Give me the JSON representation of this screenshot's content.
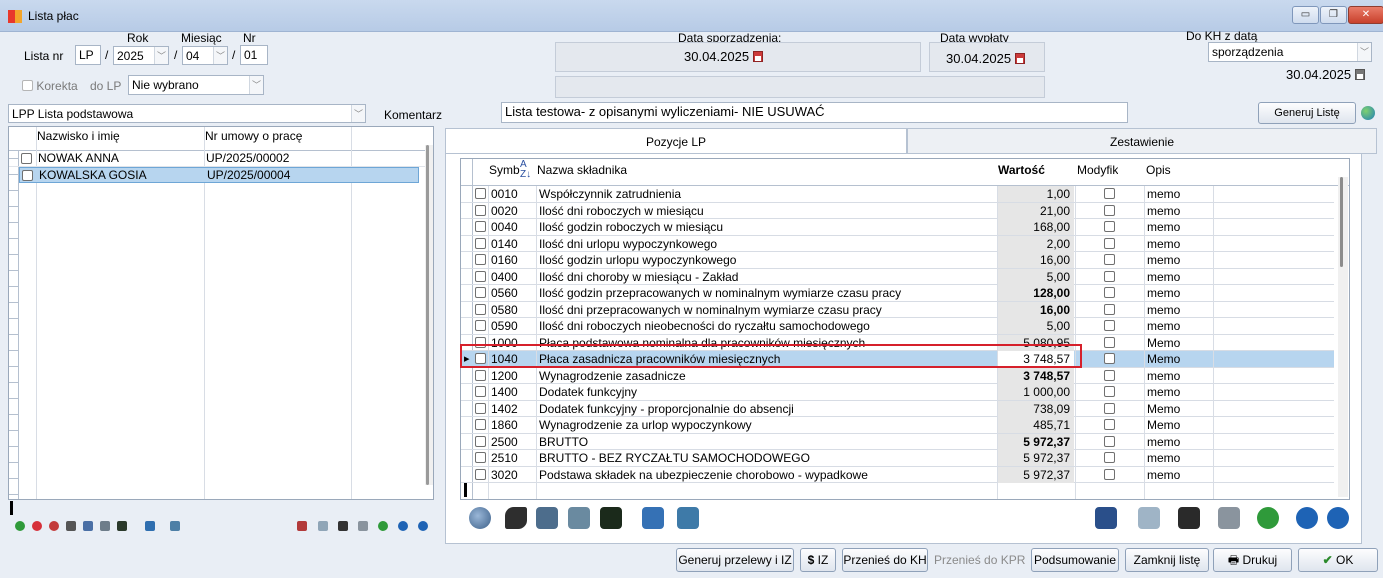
{
  "window": {
    "title": "Lista płac"
  },
  "header": {
    "lista_nr_label": "Lista nr",
    "lista_prefix": "LP",
    "rok_label": "Rok",
    "rok_value": "2025",
    "miesiac_label": "Miesiąc",
    "miesiac_value": "04",
    "nr_label": "Nr",
    "nr_value": "01",
    "sep": "/",
    "korekta_label": "Korekta",
    "do_lp_label": "do LP",
    "do_lp_value": "Nie wybrano",
    "data_sporzadzenia_label": "Data sporządzenia:",
    "data_sporzadzenia_value": "30.04.2025",
    "data_wyplaty_label": "Data wypłaty",
    "data_wyplaty_value": "30.04.2025",
    "do_kh_label": "Do KH z datą",
    "do_kh_value": "sporządzenia",
    "do_kh_date": "30.04.2025",
    "list_type": "LPP Lista podstawowa",
    "komentarz_label": "Komentarz",
    "komentarz_value": "Lista testowa- z opisanymi wyliczeniami- NIE USUWAĆ",
    "generuj_liste": "Generuj Listę"
  },
  "employees": {
    "col_name": "Nazwisko i imię",
    "col_contract": "Nr umowy o pracę",
    "rows": [
      {
        "name": "NOWAK ANNA",
        "contract": "UP/2025/00002"
      },
      {
        "name": "KOWALSKA GOSIA",
        "contract": "UP/2025/00004"
      }
    ]
  },
  "tabs": [
    {
      "label": "Pozycje LP"
    },
    {
      "label": "Zestawienie"
    }
  ],
  "components": {
    "col_symbol": "Symbol",
    "col_name": "Nazwa składnika",
    "col_value": "Wartość",
    "col_modified": "Modyfik",
    "col_desc": "Opis",
    "rows": [
      {
        "symbol": "0010",
        "name": "Współczynnik zatrudnienia",
        "value": "1,00",
        "bold": false,
        "desc": "memo"
      },
      {
        "symbol": "0020",
        "name": "Ilość dni roboczych w miesiącu",
        "value": "21,00",
        "bold": false,
        "desc": "memo"
      },
      {
        "symbol": "0040",
        "name": "Ilość godzin roboczych w miesiącu",
        "value": "168,00",
        "bold": false,
        "desc": "memo"
      },
      {
        "symbol": "0140",
        "name": "Ilość dni urlopu wypoczynkowego",
        "value": "2,00",
        "bold": false,
        "desc": "memo"
      },
      {
        "symbol": "0160",
        "name": "Ilość godzin urlopu wypoczynkowego",
        "value": "16,00",
        "bold": false,
        "desc": "memo"
      },
      {
        "symbol": "0400",
        "name": "Ilość dni choroby w miesiącu - Zakład",
        "value": "5,00",
        "bold": false,
        "desc": "memo"
      },
      {
        "symbol": "0560",
        "name": "Ilość godzin przepracowanych w nominalnym wymiarze czasu pracy",
        "value": "128,00",
        "bold": true,
        "desc": "memo"
      },
      {
        "symbol": "0580",
        "name": "Ilość dni przepracowanych w nominalnym wymiarze czasu pracy",
        "value": "16,00",
        "bold": true,
        "desc": "memo"
      },
      {
        "symbol": "0590",
        "name": "Ilość dni roboczych nieobecności do ryczałtu samochodowego",
        "value": "5,00",
        "bold": false,
        "desc": "memo"
      },
      {
        "symbol": "1000",
        "name": "Płaca podstawowa nominalna dla pracowników miesięcznych",
        "value": "5 080,95",
        "bold": false,
        "desc": "Memo"
      },
      {
        "symbol": "1040",
        "name": "Płaca zasadnicza pracowników miesięcznych",
        "value": "3 748,57",
        "bold": false,
        "desc": "Memo"
      },
      {
        "symbol": "1200",
        "name": "Wynagrodzenie zasadnicze",
        "value": "3 748,57",
        "bold": true,
        "desc": "memo"
      },
      {
        "symbol": "1400",
        "name": "Dodatek funkcyjny",
        "value": "1 000,00",
        "bold": false,
        "desc": "memo"
      },
      {
        "symbol": "1402",
        "name": "Dodatek funkcyjny - proporcjonalnie do absencji",
        "value": "738,09",
        "bold": false,
        "desc": "Memo"
      },
      {
        "symbol": "1860",
        "name": "Wynagrodzenie za urlop wypoczynkowy",
        "value": "485,71",
        "bold": false,
        "desc": "Memo"
      },
      {
        "symbol": "2500",
        "name": "BRUTTO",
        "value": "5 972,37",
        "bold": true,
        "desc": "memo"
      },
      {
        "symbol": "2510",
        "name": "BRUTTO - BEZ RYCZAŁTU SAMOCHODOWEGO",
        "value": "5 972,37",
        "bold": false,
        "desc": "memo"
      },
      {
        "symbol": "3020",
        "name": "Podstawa składek na ubezpieczenie chorobowo - wypadkowe",
        "value": "5 972,37",
        "bold": false,
        "desc": "memo"
      }
    ]
  },
  "footer": {
    "generuj_przelewy": "Generuj przelewy i IZ",
    "iz": "IZ",
    "przenies_kh": "Przenieś do KH",
    "przenies_kpr": "Przenieś do KPR",
    "podsumowanie": "Podsumowanie",
    "zamknij": "Zamknij listę",
    "drukuj": "Drukuj",
    "ok": "OK"
  }
}
